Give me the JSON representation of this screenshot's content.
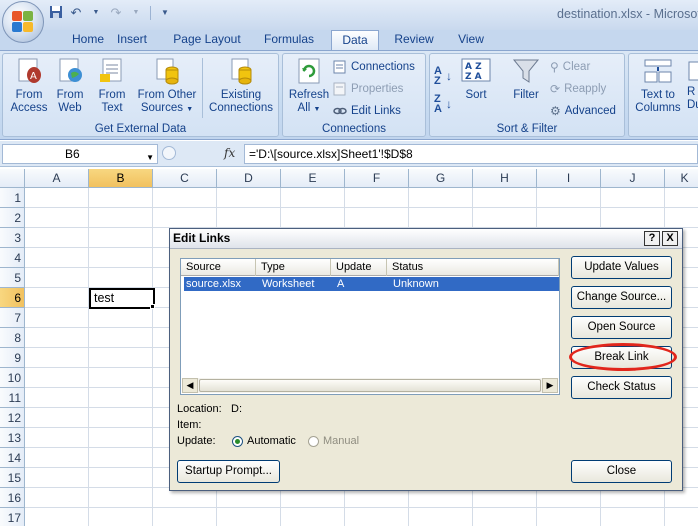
{
  "window": {
    "title": "destination.xlsx - Microsoft"
  },
  "tabs": [
    {
      "label": "Home"
    },
    {
      "label": "Insert"
    },
    {
      "label": "Page Layout"
    },
    {
      "label": "Formulas"
    },
    {
      "label": "Data"
    },
    {
      "label": "Review"
    },
    {
      "label": "View"
    }
  ],
  "ribbon": {
    "get_external_data": {
      "label": "Get External Data",
      "from_access": {
        "line1": "From",
        "line2": "Access"
      },
      "from_web": {
        "line1": "From",
        "line2": "Web"
      },
      "from_text": {
        "line1": "From",
        "line2": "Text"
      },
      "from_other": {
        "line1": "From Other",
        "line2": "Sources"
      },
      "existing": {
        "line1": "Existing",
        "line2": "Connections"
      }
    },
    "connections": {
      "label": "Connections",
      "refresh": {
        "line1": "Refresh",
        "line2": "All"
      },
      "connections_btn": "Connections",
      "properties_btn": "Properties",
      "edit_links_btn": "Edit Links"
    },
    "sort_filter": {
      "label": "Sort & Filter",
      "sort": "Sort",
      "filter": "Filter",
      "clear": "Clear",
      "reapply": "Reapply",
      "advanced": "Advanced"
    },
    "data_tools": {
      "text_to_columns": {
        "line1": "Text to",
        "line2": "Columns"
      },
      "remove_dup": {
        "line1": "R",
        "line2": "Du"
      }
    }
  },
  "formula_bar": {
    "name_box": "B6",
    "fx": "fx",
    "formula": "='D:\\[source.xlsx]Sheet1'!$D$8"
  },
  "sheet": {
    "columns": [
      "A",
      "B",
      "C",
      "D",
      "E",
      "F",
      "G",
      "H",
      "I",
      "J",
      "K"
    ],
    "rows": [
      "1",
      "2",
      "3",
      "4",
      "5",
      "6",
      "7",
      "8",
      "9",
      "10",
      "11",
      "12",
      "13",
      "14",
      "15",
      "16",
      "17"
    ],
    "selected_column": "B",
    "selected_row": "6",
    "cell_b6": "test"
  },
  "dialog": {
    "title": "Edit Links",
    "help": "?",
    "close_x": "X",
    "columns": [
      "Source",
      "Type",
      "Update",
      "Status"
    ],
    "rows": [
      {
        "source": "source.xlsx",
        "type": "Worksheet",
        "update": "A",
        "status": "Unknown"
      }
    ],
    "location_label": "Location:",
    "location_value": "D:",
    "item_label": "Item:",
    "item_value": "",
    "update_label": "Update:",
    "automatic": "Automatic",
    "manual": "Manual",
    "buttons": {
      "update_values": "Update Values",
      "change_source": "Change Source...",
      "open_source": "Open Source",
      "break_link": "Break Link",
      "check_status": "Check Status",
      "startup_prompt": "Startup Prompt...",
      "close": "Close"
    }
  },
  "colors": {
    "annotation_oval": "#e1261c",
    "selection": "#316ac5",
    "header_selected": "#f1c15f"
  }
}
